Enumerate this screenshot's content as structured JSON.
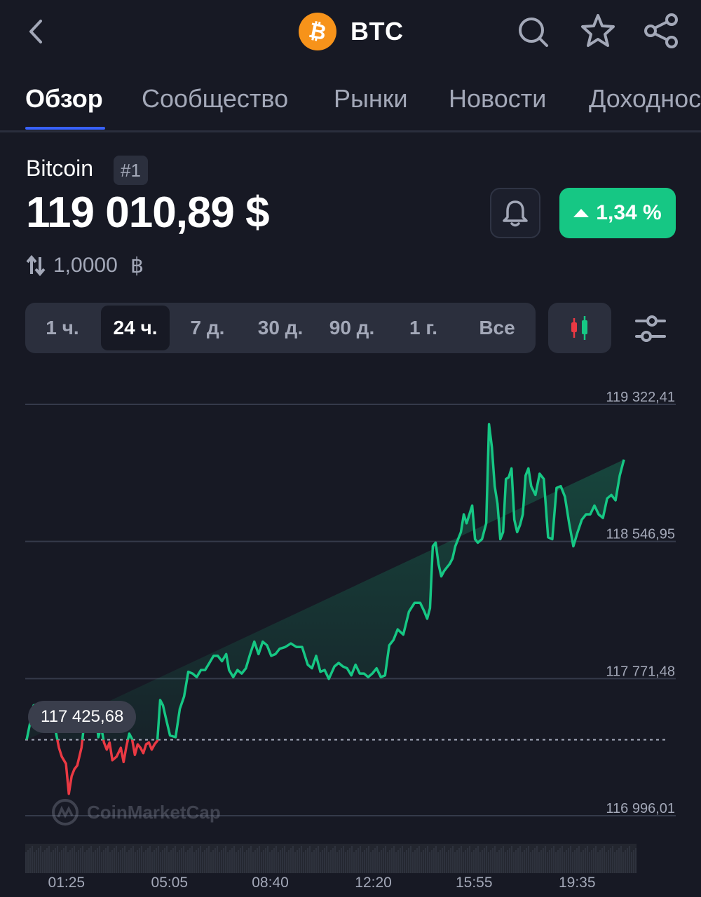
{
  "header": {
    "title": "BTC",
    "back_icon": "chevron-left-icon",
    "logo_icon": "bitcoin-logo-icon",
    "actions": [
      "search-icon",
      "star-icon",
      "share-icon"
    ]
  },
  "tabs": [
    {
      "label": "Обзор",
      "active": true
    },
    {
      "label": "Сообщество",
      "active": false
    },
    {
      "label": "Рынки",
      "active": false
    },
    {
      "label": "Новости",
      "active": false
    },
    {
      "label": "Доходнос",
      "active": false
    }
  ],
  "coin": {
    "name": "Bitcoin",
    "rank": "#1",
    "price": "119 010,89 $",
    "conversion_value": "1,0000",
    "conversion_symbol": "฿",
    "change": "1,34 %",
    "change_direction": "up"
  },
  "ranges": [
    {
      "label": "1 ч.",
      "active": false
    },
    {
      "label": "24 ч.",
      "active": true
    },
    {
      "label": "7 д.",
      "active": false
    },
    {
      "label": "30 д.",
      "active": false
    },
    {
      "label": "90 д.",
      "active": false
    },
    {
      "label": "1 г.",
      "active": false
    },
    {
      "label": "Все",
      "active": false
    }
  ],
  "colors": {
    "background": "#171924",
    "up": "#16c784",
    "down": "#ea3943",
    "accent": "#3861fb",
    "bitcoin": "#f7931a"
  },
  "watermark": "CoinMarketCap",
  "chart_data": {
    "type": "line",
    "open_value_label": "117 425,68",
    "open_value": 117425.68,
    "y_ticks": [
      "119 322,41",
      "118 546,95",
      "117 771,48",
      "116 996,01"
    ],
    "y_tick_values": [
      119322.41,
      118546.95,
      117771.48,
      116996.01
    ],
    "ylim": [
      116996.01,
      119322.41
    ],
    "x_ticks": [
      "01:25",
      "05:05",
      "08:40",
      "12:20",
      "15:55",
      "19:35"
    ],
    "x_tick_hours": [
      1.417,
      5.083,
      8.667,
      12.333,
      15.917,
      19.583
    ],
    "grid": true,
    "series": [
      {
        "x_hours": [
          0.0,
          0.25,
          0.45,
          0.6,
          0.75,
          0.85,
          1.0,
          1.15,
          1.25,
          1.4,
          1.5,
          1.6,
          1.7,
          1.8,
          1.95,
          2.05,
          2.15,
          2.25,
          2.35,
          2.45,
          2.55,
          2.65,
          2.75,
          2.85,
          2.95,
          3.05,
          3.2,
          3.35,
          3.45,
          3.55,
          3.65,
          3.75,
          3.85,
          3.95,
          4.05,
          4.15,
          4.25,
          4.35,
          4.45,
          4.55,
          4.65,
          4.75,
          4.85,
          4.95,
          5.1,
          5.3,
          5.45,
          5.6,
          5.75,
          5.9,
          6.05,
          6.2,
          6.35,
          6.5,
          6.65,
          6.8,
          6.95,
          7.1,
          7.2,
          7.35,
          7.5,
          7.65,
          7.8,
          7.95,
          8.1,
          8.25,
          8.4,
          8.55,
          8.7,
          8.85,
          9.0,
          9.2,
          9.4,
          9.6,
          9.8,
          10.0,
          10.15,
          10.3,
          10.45,
          10.6,
          10.75,
          10.95,
          11.1,
          11.25,
          11.4,
          11.55,
          11.7,
          11.85,
          12.0,
          12.15,
          12.3,
          12.45,
          12.6,
          12.75,
          12.9,
          13.05,
          13.2,
          13.4,
          13.6,
          13.8,
          14.0,
          14.15,
          14.25,
          14.35,
          14.45,
          14.55,
          14.65,
          14.75,
          14.85,
          14.95,
          15.05,
          15.15,
          15.25,
          15.35,
          15.45,
          15.55,
          15.65,
          15.75,
          15.85,
          15.95,
          16.05,
          16.2,
          16.35,
          16.45,
          16.55,
          16.65,
          16.75,
          16.85,
          16.95,
          17.05,
          17.15,
          17.25,
          17.35,
          17.45,
          17.55,
          17.65,
          17.75,
          17.85,
          17.95,
          18.1,
          18.25,
          18.4,
          18.55,
          18.7,
          18.85,
          19.0,
          19.15,
          19.3,
          19.45,
          19.6,
          19.75,
          19.9,
          20.05,
          20.2,
          20.35,
          20.5,
          20.65,
          20.8,
          20.95,
          21.1,
          21.25,
          21.45,
          21.6,
          21.7
        ],
        "values": [
          117425,
          117620,
          117630,
          117560,
          117600,
          117480,
          117500,
          117380,
          117330,
          117290,
          117120,
          117220,
          117260,
          117280,
          117380,
          117520,
          117480,
          117560,
          117570,
          117580,
          117440,
          117500,
          117410,
          117370,
          117410,
          117310,
          117330,
          117380,
          117300,
          117390,
          117460,
          117430,
          117340,
          117400,
          117380,
          117350,
          117400,
          117410,
          117370,
          117400,
          117420,
          117650,
          117620,
          117550,
          117450,
          117440,
          117600,
          117670,
          117810,
          117800,
          117780,
          117820,
          117820,
          117860,
          117900,
          117900,
          117870,
          117910,
          117820,
          117780,
          117820,
          117800,
          117830,
          117910,
          117980,
          117910,
          117980,
          117960,
          117900,
          117910,
          117940,
          117950,
          117970,
          117950,
          117950,
          117850,
          117830,
          117900,
          117810,
          117820,
          117770,
          117840,
          117860,
          117840,
          117830,
          117790,
          117850,
          117800,
          117800,
          117780,
          117800,
          117830,
          117780,
          117790,
          117960,
          117990,
          118050,
          118020,
          118150,
          118200,
          118200,
          118150,
          118110,
          118170,
          118520,
          118540,
          118420,
          118350,
          118380,
          118400,
          118420,
          118450,
          118520,
          118560,
          118600,
          118700,
          118650,
          118700,
          118750,
          118560,
          118540,
          118560,
          118650,
          119210,
          119080,
          118860,
          118760,
          118560,
          118600,
          118900,
          118910,
          118960,
          118670,
          118600,
          118640,
          118700,
          118920,
          118960,
          118860,
          118810,
          118930,
          118900,
          118570,
          118560,
          118850,
          118860,
          118800,
          118650,
          118520,
          118600,
          118670,
          118700,
          118700,
          118750,
          118700,
          118680,
          118790,
          118810,
          118780,
          118920,
          119010
        ]
      }
    ]
  }
}
